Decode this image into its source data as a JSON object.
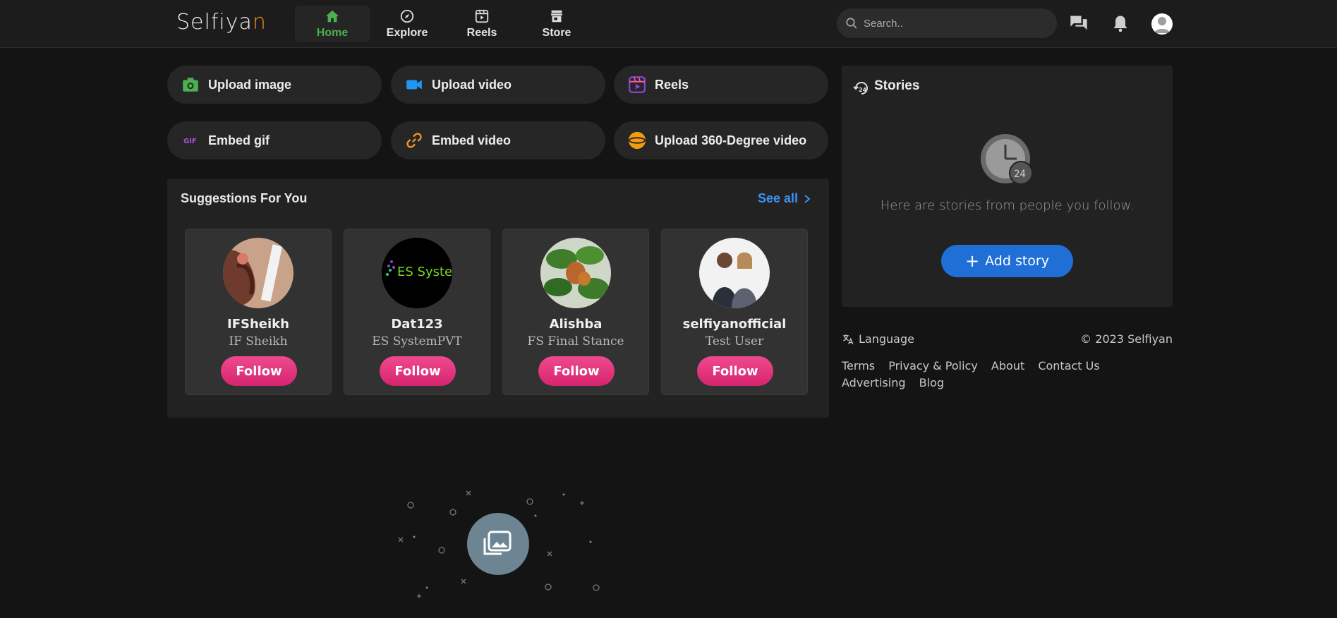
{
  "header": {
    "logo_main": "Selfiya",
    "logo_accent": "n",
    "nav": [
      {
        "label": "Home",
        "icon": "home-icon",
        "active": true
      },
      {
        "label": "Explore",
        "icon": "compass-icon",
        "active": false
      },
      {
        "label": "Reels",
        "icon": "reels-icon",
        "active": false
      },
      {
        "label": "Store",
        "icon": "store-icon",
        "active": false
      }
    ],
    "search_placeholder": "Search.."
  },
  "actions": [
    {
      "label": "Upload image",
      "icon": "camera-icon"
    },
    {
      "label": "Upload video",
      "icon": "video-camera-icon"
    },
    {
      "label": "Reels",
      "icon": "reels-icon"
    },
    {
      "label": "Embed gif",
      "icon": "gif-icon"
    },
    {
      "label": "Embed video",
      "icon": "link-icon"
    },
    {
      "label": "Upload 360-Degree video",
      "icon": "vr-icon"
    }
  ],
  "gif_badge": "GIF",
  "suggestions": {
    "title": "Suggestions For You",
    "see_all": "See all",
    "follow_label": "Follow",
    "users": [
      {
        "username": "IFSheikh",
        "name": "IF Sheikh"
      },
      {
        "username": "Dat123",
        "name": "ES SystemPVT",
        "avatar_text": "ES System"
      },
      {
        "username": "Alishba",
        "name": "FS Final Stance"
      },
      {
        "username": "selfiyanofficial",
        "name": "Test User"
      }
    ]
  },
  "stories": {
    "title": "Stories",
    "badge": "24",
    "empty_text": "Here are stories from people you follow.",
    "add_label": "Add story",
    "add_icon": "+"
  },
  "footer": {
    "language": "Language",
    "copyright": "© 2023 Selfiyan",
    "links": [
      "Terms",
      "Privacy & Policy",
      "About",
      "Contact Us",
      "Advertising",
      "Blog"
    ]
  },
  "colors": {
    "accent_green": "#4caf50",
    "link_blue": "#3b93f0",
    "follow_pink": "#e3377f",
    "add_story_blue": "#1f6fd6",
    "logo_orange": "#f08a1c"
  }
}
